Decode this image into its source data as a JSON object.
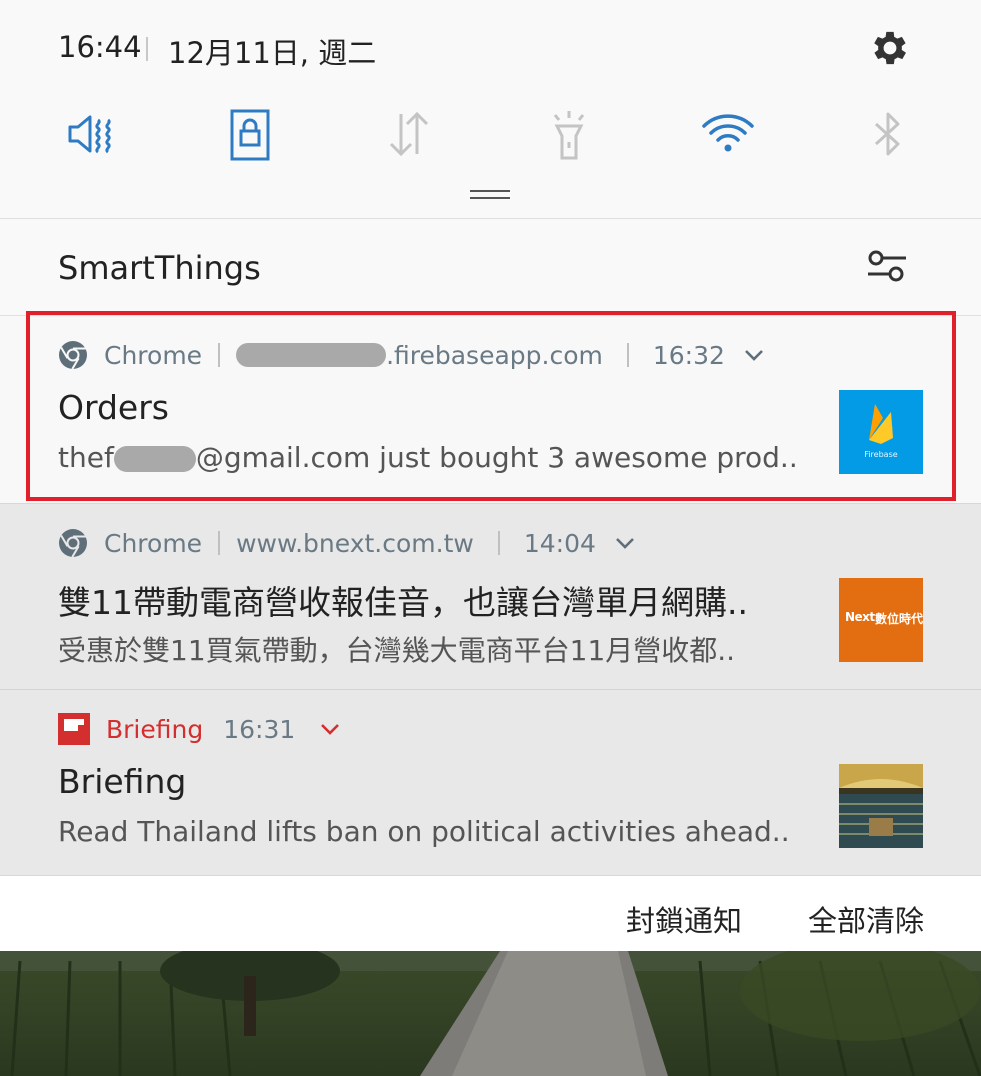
{
  "status": {
    "time": "16:44",
    "date": "12月11日, 週二",
    "settings_icon": "gear-icon"
  },
  "quick_settings": {
    "toggles": [
      {
        "name": "sound-vibrate",
        "icon": "vibrate-icon",
        "active": true
      },
      {
        "name": "screen-lock",
        "icon": "lock-rotation-icon",
        "active": true
      },
      {
        "name": "mobile-data",
        "icon": "data-arrows-icon",
        "active": false
      },
      {
        "name": "flashlight",
        "icon": "flashlight-icon",
        "active": false
      },
      {
        "name": "wifi",
        "icon": "wifi-icon",
        "active": true
      },
      {
        "name": "bluetooth",
        "icon": "bluetooth-icon",
        "active": false
      }
    ],
    "active_color": "#2e7bc4",
    "inactive_color": "#c4c4c4"
  },
  "smartthings": {
    "title": "SmartThings"
  },
  "notifications": [
    {
      "app": "Chrome",
      "source_domain": ".firebaseapp.com",
      "time": "16:32",
      "title": "Orders",
      "text_prefix": "thef",
      "text_suffix": "@gmail.com just bought 3 awesome prod..",
      "thumbnail_label": "Firebase",
      "highlighted": true
    },
    {
      "app": "Chrome",
      "source_domain": "www.bnext.com.tw",
      "time": "14:04",
      "title": "雙11帶動電商營收報佳音，也讓台灣單月網購..",
      "text": "受惠於雙11買氣帶動，台灣幾大電商平台11月營收都..",
      "thumbnail_label": "數位時代",
      "thumbnail_small": "Next"
    },
    {
      "app": "Briefing",
      "time": "16:31",
      "title": "Briefing",
      "text": "Read Thailand lifts ban on political activities ahead.."
    }
  ],
  "actions": {
    "block": "封鎖通知",
    "clear_all": "全部清除"
  },
  "colors": {
    "highlight": "#e0202a",
    "briefing_red": "#d32f2f",
    "firebase_bg": "#039be5",
    "bnext_bg": "#e36e12"
  }
}
